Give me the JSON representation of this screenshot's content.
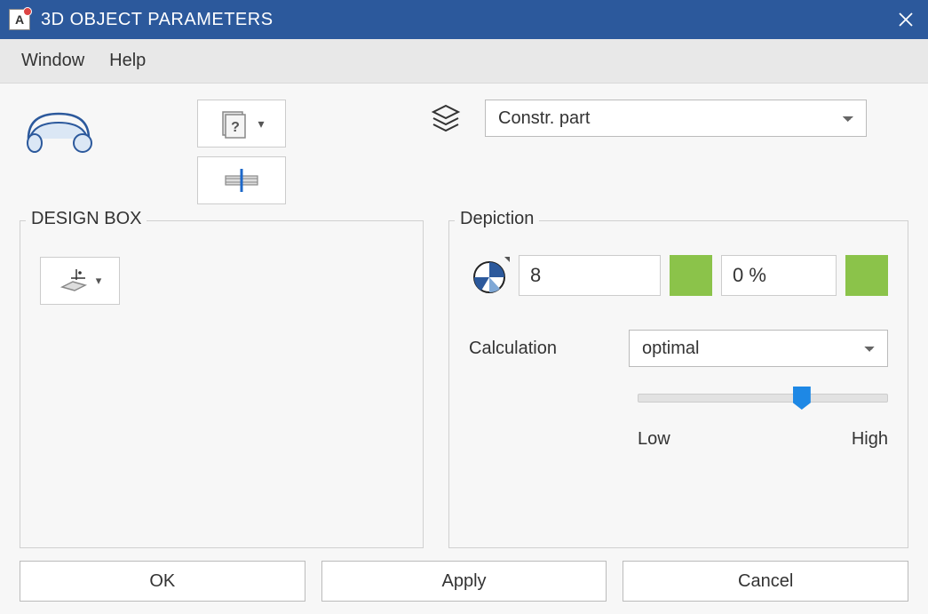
{
  "title": "3D OBJECT PARAMETERS",
  "menu": {
    "window": "Window",
    "help": "Help"
  },
  "layer": {
    "selected": "Constr. part"
  },
  "designBox": {
    "legend": "DESIGN BOX"
  },
  "depiction": {
    "legend": "Depiction",
    "value1": "8",
    "value2": "0 %",
    "calcLabel": "Calculation",
    "calcSelected": "optimal",
    "sliderLow": "Low",
    "sliderHigh": "High"
  },
  "buttons": {
    "ok": "OK",
    "apply": "Apply",
    "cancel": "Cancel"
  }
}
